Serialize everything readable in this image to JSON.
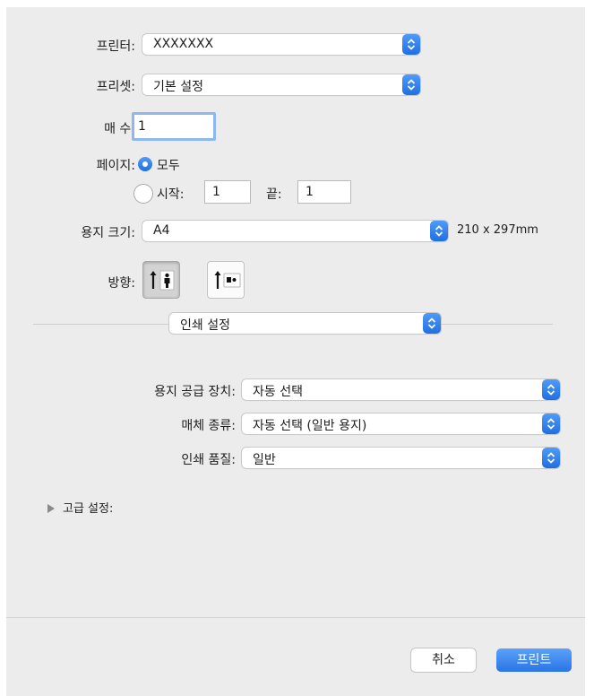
{
  "printer": {
    "label": "프린터:",
    "value": "XXXXXXX"
  },
  "presets": {
    "label": "프리셋:",
    "value": "기본 설정"
  },
  "copies": {
    "label": "매 수:",
    "value": "1"
  },
  "pages": {
    "label": "페이지:",
    "all_label": "모두",
    "from_label": "시작:",
    "from_value": "1",
    "to_label": "끝:",
    "to_value": "1"
  },
  "paper_size": {
    "label": "용지 크기:",
    "value": "A4",
    "dimensions": "210 x 297mm"
  },
  "orientation": {
    "label": "방향:",
    "selected": "portrait",
    "options": [
      "portrait-icon",
      "landscape-icon"
    ]
  },
  "section_popup": {
    "value": "인쇄 설정"
  },
  "print_settings": {
    "paper_source": {
      "label": "용지 공급 장치:",
      "value": "자동 선택"
    },
    "media_type": {
      "label": "매체 종류:",
      "value": "자동 선택 (일반 용지)"
    },
    "print_quality": {
      "label": "인쇄 품질:",
      "value": "일반"
    }
  },
  "advanced": {
    "label": "고급 설정:"
  },
  "buttons": {
    "cancel": "취소",
    "print": "프린트"
  },
  "colors": {
    "accent": "#2a74e6",
    "background": "#ececec"
  }
}
